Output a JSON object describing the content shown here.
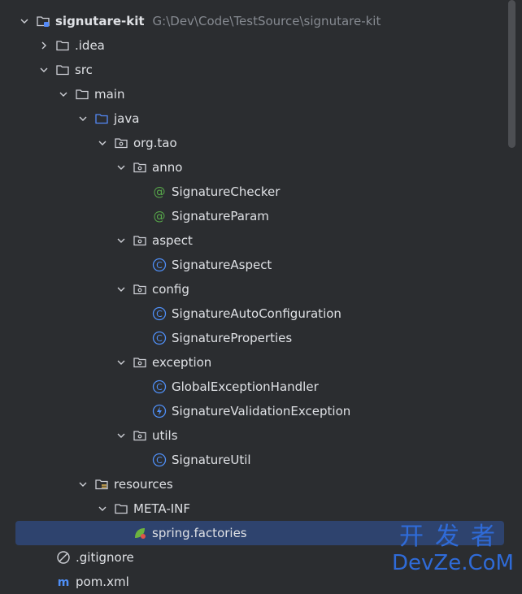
{
  "project": {
    "name": "signutare-kit",
    "path": "G:\\Dev\\Code\\TestSource\\signutare-kit"
  },
  "tree": {
    "idea": ".idea",
    "src": "src",
    "main": "main",
    "java": "java",
    "org_tao": "org.tao",
    "anno": "anno",
    "signature_checker": "SignatureChecker",
    "signature_param": "SignatureParam",
    "aspect": "aspect",
    "signature_aspect": "SignatureAspect",
    "config": "config",
    "signature_auto_configuration": "SignatureAutoConfiguration",
    "signature_properties": "SignatureProperties",
    "exception": "exception",
    "global_exception_handler": "GlobalExceptionHandler",
    "signature_validation_exception": "SignatureValidationException",
    "utils": "utils",
    "signature_util": "SignatureUtil",
    "resources": "resources",
    "meta_inf": "META-INF",
    "spring_factories": "spring.factories",
    "gitignore": ".gitignore",
    "pom_xml": "pom.xml"
  },
  "watermark": {
    "line1": "开发者",
    "line2": "DevZe.CoM"
  },
  "colors": {
    "background": "#2b2d30",
    "selection": "#2e436e",
    "annotation_icon": "#57a64a",
    "class_icon": "#4f8ff7",
    "folder_blue": "#548af7"
  }
}
